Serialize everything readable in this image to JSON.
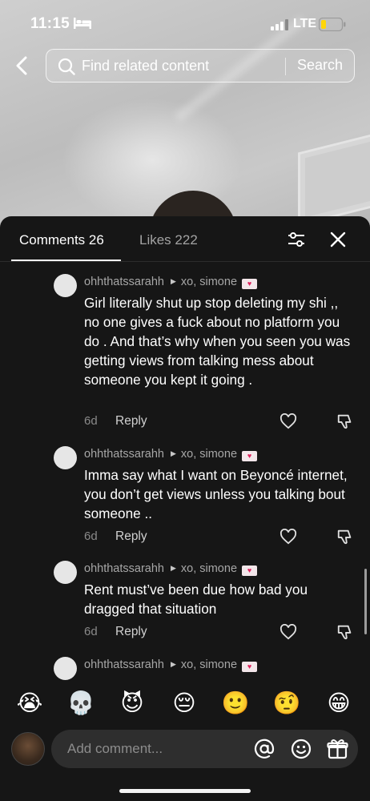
{
  "status_bar": {
    "time": "11:15",
    "network": "LTE"
  },
  "search": {
    "placeholder": "Find related content",
    "button_label": "Search"
  },
  "tabs": {
    "comments_label": "Comments 26",
    "likes_label": "Likes 222"
  },
  "comments": [
    {
      "username": "ohhthatssarahh",
      "reply_to": "xo, simone",
      "text": "Girl literally shut up stop deleting my shi ,, no one gives a fuck about no platform you do . And that’s why when you seen you was getting views from talking mess about someone you kept it going .",
      "age": "6d",
      "reply_label": "Reply"
    },
    {
      "username": "ohhthatssarahh",
      "reply_to": "xo, simone",
      "text": "Imma say what I want on Beyoncé internet, you don’t get views unless you talking bout someone ..",
      "age": "6d",
      "reply_label": "Reply"
    },
    {
      "username": "ohhthatssarahh",
      "reply_to": "xo, simone",
      "text": "Rent must’ve been due how bad you dragged that situation",
      "age": "6d",
      "reply_label": "Reply"
    },
    {
      "username": "ohhthatssarahh",
      "reply_to": "xo, simone"
    }
  ],
  "emojis": [
    "😭",
    "💀",
    "😈",
    "😔",
    "🙂",
    "🤨",
    "😁"
  ],
  "composer": {
    "placeholder": "Add comment..."
  },
  "colors": {
    "panel_bg": "#161616",
    "input_bg": "#2e2e2e",
    "heart_badge": "#e0245e"
  }
}
